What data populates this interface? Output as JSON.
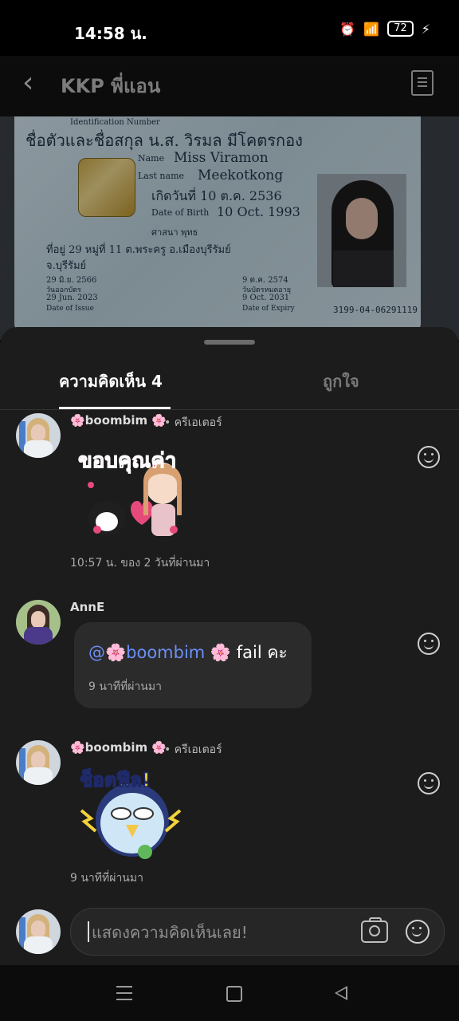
{
  "status_bar": {
    "time": "14:58 น.",
    "battery": "72"
  },
  "header": {
    "title": "KKP พี่แอน",
    "back_icon": "chevron-left-icon",
    "menu_icon": "document-icon"
  },
  "photo_card": {
    "header_label": "Identification Number",
    "name_th": "ชื่อตัวและชื่อสกุล น.ส. วิรมล มีโคตรกอง",
    "name_label": "Name",
    "name_en": "Miss Viramon",
    "lastname_label": "Last name",
    "lastname_en": "Meekotkong",
    "dob_th": "เกิดวันที่ 10 ต.ค. 2536",
    "dob_label": "Date of Birth",
    "dob_en": "10 Oct. 1993",
    "religion": "ศาสนา พุทธ",
    "address_1": "ที่อยู่ 29 หมู่ที่ 11 ต.พระครู อ.เมืองบุรีรัมย์",
    "address_2": "จ.บุรีรัมย์",
    "issue_th": "29 มิ.ย. 2566",
    "issue_label_th": "วันออกบัตร",
    "issue_en": "29 Jun. 2023",
    "issue_label_en": "Date of Issue",
    "expiry_th": "9 ต.ค. 2574",
    "expiry_label_th": "วันบัตรหมดอายุ",
    "expiry_en": "9 Oct. 2031",
    "expiry_label_en": "Date of Expiry",
    "card_code": "3199-04-06291119"
  },
  "tabs": {
    "comments": "ความคิดเห็น 4",
    "likes": "ถูกใจ"
  },
  "comments": [
    {
      "username": "🌸boombim 🌸",
      "badge": "ครีเอเตอร์",
      "sticker_text": "ขอบคุณค่า",
      "time": "10:57 น. ของ 2 วันที่ผ่านมา"
    },
    {
      "username": "AnnE",
      "mention": "@🌸boombim 🌸",
      "text": " fail คะ",
      "time": "9 นาทีที่ผ่านมา"
    },
    {
      "username": "🌸boombim 🌸",
      "badge": "ครีเอเตอร์",
      "sticker_text": "ช็อตฟีล!",
      "time": "9 นาทีที่ผ่านมา"
    }
  ],
  "input": {
    "placeholder": "แสดงความคิดเห็นเลย!"
  },
  "colors": {
    "mention": "#6b8ff5",
    "sheet": "#1c1c1d",
    "bubble": "#2b2b2c"
  }
}
